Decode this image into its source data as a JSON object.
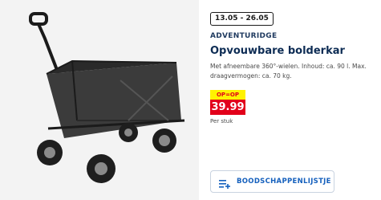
{
  "product": {
    "image_alt": "Opvouwbare bolderkar",
    "date_range": "13.05 - 26.05",
    "brand": "ADVENTURIDGE",
    "title": "Opvouwbare bolderkar",
    "description": "Met afneembare 360°-wielen. Inhoud: ca. 90 l. Max. draagvermogen: ca. 70 kg.",
    "price_tag": "OP=OP",
    "price": "39.99",
    "price_unit": "Per stuk"
  },
  "actions": {
    "shopping_list_label": "BOODSCHAPPENLIJSTJE",
    "shopping_list_icon": "add-to-list-icon"
  },
  "colors": {
    "brand_blue": "#0d2c54",
    "accent_blue": "#1560bd",
    "price_red": "#e2001a",
    "tag_yellow": "#fff200"
  }
}
